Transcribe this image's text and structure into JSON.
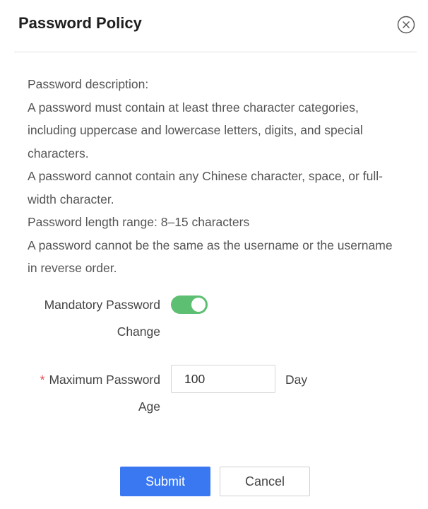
{
  "dialog": {
    "title": "Password Policy",
    "close_icon": "close-circle-icon"
  },
  "description": {
    "lines": [
      "Password description:",
      "A password must contain at least three character categories,",
      "including uppercase and lowercase letters, digits, and special",
      "characters.",
      "A password cannot contain any Chinese character, space, or full-",
      "width character.",
      "Password length range: 8–15 characters",
      "A password cannot be the same as the username or the username",
      "in reverse order."
    ]
  },
  "form": {
    "mandatory_change": {
      "label_line1": "Mandatory Password",
      "label_line2": "Change",
      "enabled": true,
      "accent": "#5cbf72"
    },
    "max_age": {
      "required_mark": "*",
      "label_line1": "Maximum Password",
      "label_line2": "Age",
      "value": "100",
      "unit": "Day"
    }
  },
  "buttons": {
    "submit_label": "Submit",
    "cancel_label": "Cancel",
    "primary_color": "#3a78f2"
  }
}
